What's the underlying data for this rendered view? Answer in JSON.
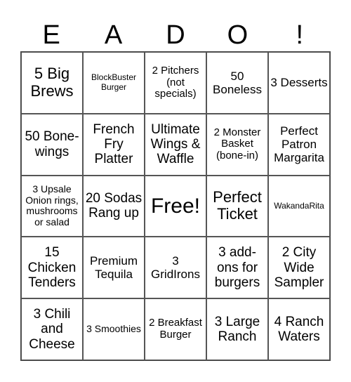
{
  "header": [
    "E",
    "A",
    "D",
    "O",
    "!"
  ],
  "cells": [
    {
      "text": "5 Big Brews",
      "size": "s-l"
    },
    {
      "text": "BlockBuster Burger",
      "size": "s-xs"
    },
    {
      "text": "2 Pitchers (not specials)",
      "size": "s-sm"
    },
    {
      "text": "50 Boneless",
      "size": "s-m"
    },
    {
      "text": "3 Desserts",
      "size": "s-m"
    },
    {
      "text": "50 Bone-wings",
      "size": "s-ml"
    },
    {
      "text": "French Fry Platter",
      "size": "s-ml"
    },
    {
      "text": "Ultimate Wings & Waffle",
      "size": "s-ml"
    },
    {
      "text": "2 Monster Basket (bone-in)",
      "size": "s-sm"
    },
    {
      "text": "Perfect Patron Margarita",
      "size": "s-m"
    },
    {
      "text": "3 Upsale Onion rings, mushrooms or salad",
      "size": "s-s"
    },
    {
      "text": "20 Sodas Rang up",
      "size": "s-ml"
    },
    {
      "text": "Free!",
      "size": "s-xl"
    },
    {
      "text": "Perfect Ticket",
      "size": "s-l"
    },
    {
      "text": "WakandaRita",
      "size": "s-xs"
    },
    {
      "text": "15 Chicken Tenders",
      "size": "s-ml"
    },
    {
      "text": "Premium Tequila",
      "size": "s-m"
    },
    {
      "text": "3 GridIrons",
      "size": "s-m"
    },
    {
      "text": "3 add-ons for burgers",
      "size": "s-ml"
    },
    {
      "text": "2 City Wide Sampler",
      "size": "s-ml"
    },
    {
      "text": "3 Chili and Cheese",
      "size": "s-ml"
    },
    {
      "text": "3 Smoothies",
      "size": "s-s"
    },
    {
      "text": "2 Breakfast Burger",
      "size": "s-sm"
    },
    {
      "text": "3 Large Ranch",
      "size": "s-ml"
    },
    {
      "text": "4 Ranch Waters",
      "size": "s-ml"
    }
  ]
}
